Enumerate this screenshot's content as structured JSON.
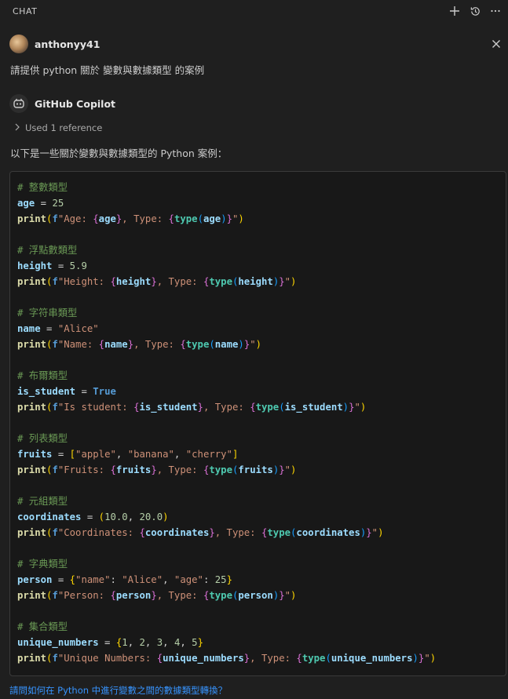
{
  "panel": {
    "title": "CHAT",
    "actions": [
      {
        "icon": "plus-icon"
      },
      {
        "icon": "history-icon"
      },
      {
        "icon": "more-icon"
      }
    ]
  },
  "user_message": {
    "username": "anthonyy41",
    "text": "請提供 python 關於 變數與數據類型 的案例"
  },
  "assistant": {
    "name": "GitHub Copilot",
    "used_reference": "Used 1 reference",
    "intro": "以下是一些關於變數與數據類型的 Python 案例："
  },
  "code_lines": [
    [
      {
        "t": "# 整數類型",
        "c": "c-com"
      }
    ],
    [
      {
        "t": "age",
        "c": "c-var"
      },
      {
        "t": " = ",
        "c": "c-op"
      },
      {
        "t": "25",
        "c": "c-num"
      }
    ],
    [
      {
        "t": "print",
        "c": "c-fn"
      },
      {
        "t": "(",
        "c": "b1"
      },
      {
        "t": "f",
        "c": "c-fp"
      },
      {
        "t": "\"Age: ",
        "c": "c-str"
      },
      {
        "t": "{",
        "c": "b2"
      },
      {
        "t": "age",
        "c": "c-var"
      },
      {
        "t": "}",
        "c": "b2"
      },
      {
        "t": ", Type: ",
        "c": "c-str"
      },
      {
        "t": "{",
        "c": "b2"
      },
      {
        "t": "type",
        "c": "c-typ"
      },
      {
        "t": "(",
        "c": "b3"
      },
      {
        "t": "age",
        "c": "c-var"
      },
      {
        "t": ")",
        "c": "b3"
      },
      {
        "t": "}",
        "c": "b2"
      },
      {
        "t": "\"",
        "c": "c-str"
      },
      {
        "t": ")",
        "c": "b1"
      }
    ],
    [],
    [
      {
        "t": "# 浮點數類型",
        "c": "c-com"
      }
    ],
    [
      {
        "t": "height",
        "c": "c-var"
      },
      {
        "t": " = ",
        "c": "c-op"
      },
      {
        "t": "5.9",
        "c": "c-num"
      }
    ],
    [
      {
        "t": "print",
        "c": "c-fn"
      },
      {
        "t": "(",
        "c": "b1"
      },
      {
        "t": "f",
        "c": "c-fp"
      },
      {
        "t": "\"Height: ",
        "c": "c-str"
      },
      {
        "t": "{",
        "c": "b2"
      },
      {
        "t": "height",
        "c": "c-var"
      },
      {
        "t": "}",
        "c": "b2"
      },
      {
        "t": ", Type: ",
        "c": "c-str"
      },
      {
        "t": "{",
        "c": "b2"
      },
      {
        "t": "type",
        "c": "c-typ"
      },
      {
        "t": "(",
        "c": "b3"
      },
      {
        "t": "height",
        "c": "c-var"
      },
      {
        "t": ")",
        "c": "b3"
      },
      {
        "t": "}",
        "c": "b2"
      },
      {
        "t": "\"",
        "c": "c-str"
      },
      {
        "t": ")",
        "c": "b1"
      }
    ],
    [],
    [
      {
        "t": "# 字符串類型",
        "c": "c-com"
      }
    ],
    [
      {
        "t": "name",
        "c": "c-var"
      },
      {
        "t": " = ",
        "c": "c-op"
      },
      {
        "t": "\"Alice\"",
        "c": "c-str"
      }
    ],
    [
      {
        "t": "print",
        "c": "c-fn"
      },
      {
        "t": "(",
        "c": "b1"
      },
      {
        "t": "f",
        "c": "c-fp"
      },
      {
        "t": "\"Name: ",
        "c": "c-str"
      },
      {
        "t": "{",
        "c": "b2"
      },
      {
        "t": "name",
        "c": "c-var"
      },
      {
        "t": "}",
        "c": "b2"
      },
      {
        "t": ", Type: ",
        "c": "c-str"
      },
      {
        "t": "{",
        "c": "b2"
      },
      {
        "t": "type",
        "c": "c-typ"
      },
      {
        "t": "(",
        "c": "b3"
      },
      {
        "t": "name",
        "c": "c-var"
      },
      {
        "t": ")",
        "c": "b3"
      },
      {
        "t": "}",
        "c": "b2"
      },
      {
        "t": "\"",
        "c": "c-str"
      },
      {
        "t": ")",
        "c": "b1"
      }
    ],
    [],
    [
      {
        "t": "# 布爾類型",
        "c": "c-com"
      }
    ],
    [
      {
        "t": "is_student",
        "c": "c-var"
      },
      {
        "t": " = ",
        "c": "c-op"
      },
      {
        "t": "True",
        "c": "c-kw"
      }
    ],
    [
      {
        "t": "print",
        "c": "c-fn"
      },
      {
        "t": "(",
        "c": "b1"
      },
      {
        "t": "f",
        "c": "c-fp"
      },
      {
        "t": "\"Is student: ",
        "c": "c-str"
      },
      {
        "t": "{",
        "c": "b2"
      },
      {
        "t": "is_student",
        "c": "c-var"
      },
      {
        "t": "}",
        "c": "b2"
      },
      {
        "t": ", Type: ",
        "c": "c-str"
      },
      {
        "t": "{",
        "c": "b2"
      },
      {
        "t": "type",
        "c": "c-typ"
      },
      {
        "t": "(",
        "c": "b3"
      },
      {
        "t": "is_student",
        "c": "c-var"
      },
      {
        "t": ")",
        "c": "b3"
      },
      {
        "t": "}",
        "c": "b2"
      },
      {
        "t": "\"",
        "c": "c-str"
      },
      {
        "t": ")",
        "c": "b1"
      }
    ],
    [],
    [
      {
        "t": "# 列表類型",
        "c": "c-com"
      }
    ],
    [
      {
        "t": "fruits",
        "c": "c-var"
      },
      {
        "t": " = ",
        "c": "c-op"
      },
      {
        "t": "[",
        "c": "b1"
      },
      {
        "t": "\"apple\"",
        "c": "c-str"
      },
      {
        "t": ", ",
        "c": "c-op"
      },
      {
        "t": "\"banana\"",
        "c": "c-str"
      },
      {
        "t": ", ",
        "c": "c-op"
      },
      {
        "t": "\"cherry\"",
        "c": "c-str"
      },
      {
        "t": "]",
        "c": "b1"
      }
    ],
    [
      {
        "t": "print",
        "c": "c-fn"
      },
      {
        "t": "(",
        "c": "b1"
      },
      {
        "t": "f",
        "c": "c-fp"
      },
      {
        "t": "\"Fruits: ",
        "c": "c-str"
      },
      {
        "t": "{",
        "c": "b2"
      },
      {
        "t": "fruits",
        "c": "c-var"
      },
      {
        "t": "}",
        "c": "b2"
      },
      {
        "t": ", Type: ",
        "c": "c-str"
      },
      {
        "t": "{",
        "c": "b2"
      },
      {
        "t": "type",
        "c": "c-typ"
      },
      {
        "t": "(",
        "c": "b3"
      },
      {
        "t": "fruits",
        "c": "c-var"
      },
      {
        "t": ")",
        "c": "b3"
      },
      {
        "t": "}",
        "c": "b2"
      },
      {
        "t": "\"",
        "c": "c-str"
      },
      {
        "t": ")",
        "c": "b1"
      }
    ],
    [],
    [
      {
        "t": "# 元組類型",
        "c": "c-com"
      }
    ],
    [
      {
        "t": "coordinates",
        "c": "c-var"
      },
      {
        "t": " = ",
        "c": "c-op"
      },
      {
        "t": "(",
        "c": "b1"
      },
      {
        "t": "10.0",
        "c": "c-num"
      },
      {
        "t": ", ",
        "c": "c-op"
      },
      {
        "t": "20.0",
        "c": "c-num"
      },
      {
        "t": ")",
        "c": "b1"
      }
    ],
    [
      {
        "t": "print",
        "c": "c-fn"
      },
      {
        "t": "(",
        "c": "b1"
      },
      {
        "t": "f",
        "c": "c-fp"
      },
      {
        "t": "\"Coordinates: ",
        "c": "c-str"
      },
      {
        "t": "{",
        "c": "b2"
      },
      {
        "t": "coordinates",
        "c": "c-var"
      },
      {
        "t": "}",
        "c": "b2"
      },
      {
        "t": ", Type: ",
        "c": "c-str"
      },
      {
        "t": "{",
        "c": "b2"
      },
      {
        "t": "type",
        "c": "c-typ"
      },
      {
        "t": "(",
        "c": "b3"
      },
      {
        "t": "coordinates",
        "c": "c-var"
      },
      {
        "t": ")",
        "c": "b3"
      },
      {
        "t": "}",
        "c": "b2"
      },
      {
        "t": "\"",
        "c": "c-str"
      },
      {
        "t": ")",
        "c": "b1"
      }
    ],
    [],
    [
      {
        "t": "# 字典類型",
        "c": "c-com"
      }
    ],
    [
      {
        "t": "person",
        "c": "c-var"
      },
      {
        "t": " = ",
        "c": "c-op"
      },
      {
        "t": "{",
        "c": "b1"
      },
      {
        "t": "\"name\"",
        "c": "c-str"
      },
      {
        "t": ": ",
        "c": "c-op"
      },
      {
        "t": "\"Alice\"",
        "c": "c-str"
      },
      {
        "t": ", ",
        "c": "c-op"
      },
      {
        "t": "\"age\"",
        "c": "c-str"
      },
      {
        "t": ": ",
        "c": "c-op"
      },
      {
        "t": "25",
        "c": "c-num"
      },
      {
        "t": "}",
        "c": "b1"
      }
    ],
    [
      {
        "t": "print",
        "c": "c-fn"
      },
      {
        "t": "(",
        "c": "b1"
      },
      {
        "t": "f",
        "c": "c-fp"
      },
      {
        "t": "\"Person: ",
        "c": "c-str"
      },
      {
        "t": "{",
        "c": "b2"
      },
      {
        "t": "person",
        "c": "c-var"
      },
      {
        "t": "}",
        "c": "b2"
      },
      {
        "t": ", Type: ",
        "c": "c-str"
      },
      {
        "t": "{",
        "c": "b2"
      },
      {
        "t": "type",
        "c": "c-typ"
      },
      {
        "t": "(",
        "c": "b3"
      },
      {
        "t": "person",
        "c": "c-var"
      },
      {
        "t": ")",
        "c": "b3"
      },
      {
        "t": "}",
        "c": "b2"
      },
      {
        "t": "\"",
        "c": "c-str"
      },
      {
        "t": ")",
        "c": "b1"
      }
    ],
    [],
    [
      {
        "t": "# 集合類型",
        "c": "c-com"
      }
    ],
    [
      {
        "t": "unique_numbers",
        "c": "c-var"
      },
      {
        "t": " = ",
        "c": "c-op"
      },
      {
        "t": "{",
        "c": "b1"
      },
      {
        "t": "1",
        "c": "c-num"
      },
      {
        "t": ", ",
        "c": "c-op"
      },
      {
        "t": "2",
        "c": "c-num"
      },
      {
        "t": ", ",
        "c": "c-op"
      },
      {
        "t": "3",
        "c": "c-num"
      },
      {
        "t": ", ",
        "c": "c-op"
      },
      {
        "t": "4",
        "c": "c-num"
      },
      {
        "t": ", ",
        "c": "c-op"
      },
      {
        "t": "5",
        "c": "c-num"
      },
      {
        "t": "}",
        "c": "b1"
      }
    ],
    [
      {
        "t": "print",
        "c": "c-fn"
      },
      {
        "t": "(",
        "c": "b1"
      },
      {
        "t": "f",
        "c": "c-fp"
      },
      {
        "t": "\"Unique Numbers: ",
        "c": "c-str"
      },
      {
        "t": "{",
        "c": "b2"
      },
      {
        "t": "unique_numbers",
        "c": "c-var"
      },
      {
        "t": "}",
        "c": "b2"
      },
      {
        "t": ", Type: ",
        "c": "c-str"
      },
      {
        "t": "{",
        "c": "b2"
      },
      {
        "t": "type",
        "c": "c-typ"
      },
      {
        "t": "(",
        "c": "b3"
      },
      {
        "t": "unique_numbers",
        "c": "c-var"
      },
      {
        "t": ")",
        "c": "b3"
      },
      {
        "t": "}",
        "c": "b2"
      },
      {
        "t": "\"",
        "c": "c-str"
      },
      {
        "t": ")",
        "c": "b1"
      }
    ]
  ],
  "followup": "請問如何在 Python 中進行變數之間的數據類型轉換？",
  "colors": {
    "background": "#1f1f1f",
    "code_background": "#181818",
    "link": "#3794ff"
  }
}
